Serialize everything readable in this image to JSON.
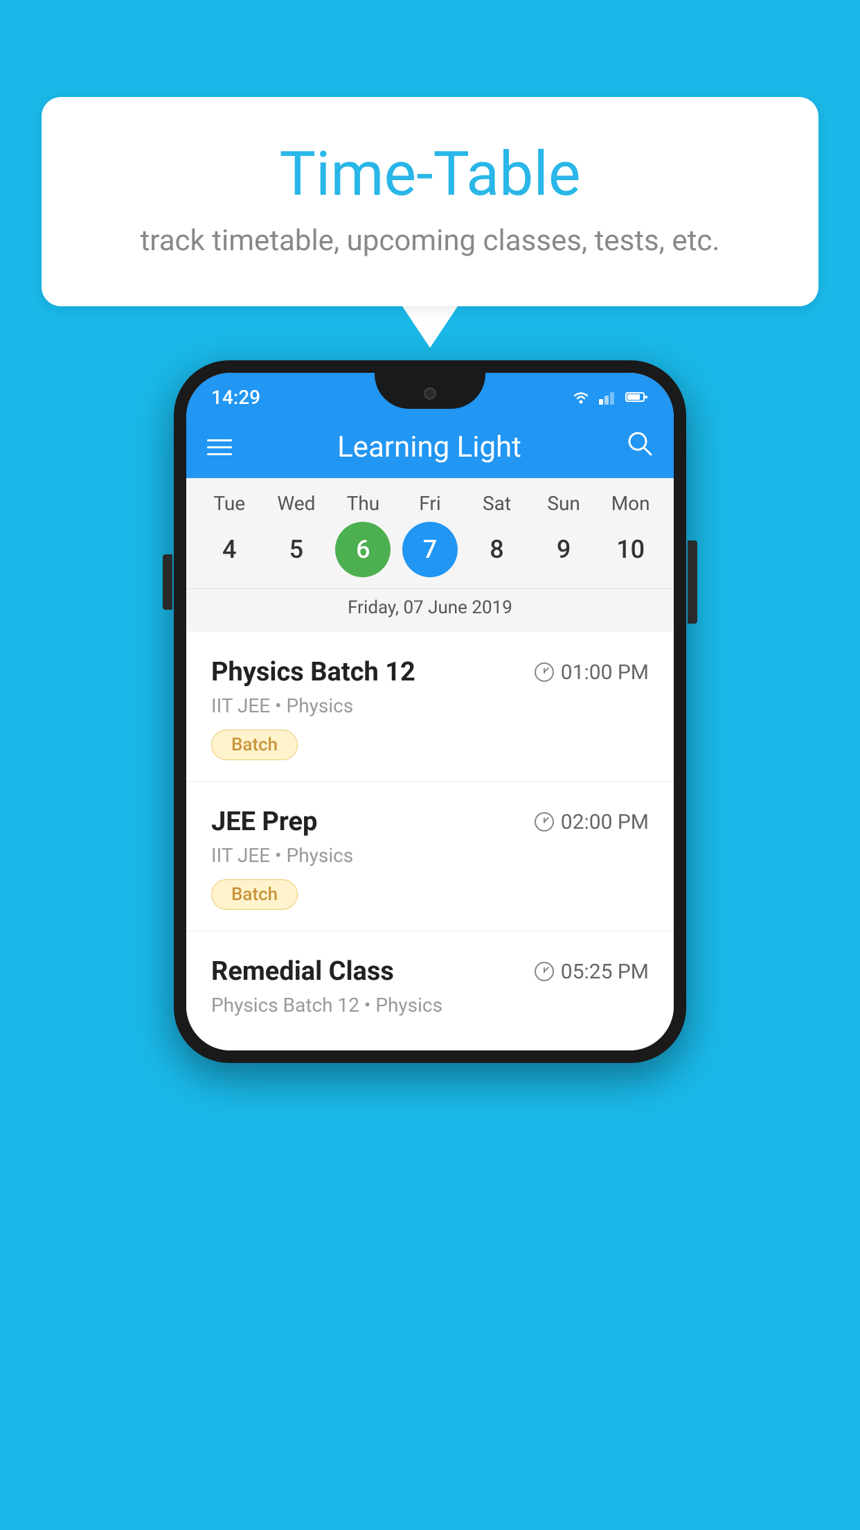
{
  "background_color": "#1ab8e8",
  "speech_bubble": {
    "title": "Time-Table",
    "subtitle": "track timetable, upcoming classes, tests, etc."
  },
  "phone": {
    "status_bar": {
      "time": "14:29"
    },
    "app_bar": {
      "title": "Learning Light"
    },
    "calendar": {
      "days": [
        {
          "label": "Tue",
          "number": "4"
        },
        {
          "label": "Wed",
          "number": "5"
        },
        {
          "label": "Thu",
          "number": "6",
          "state": "today"
        },
        {
          "label": "Fri",
          "number": "7",
          "state": "selected"
        },
        {
          "label": "Sat",
          "number": "8"
        },
        {
          "label": "Sun",
          "number": "9"
        },
        {
          "label": "Mon",
          "number": "10"
        }
      ],
      "selected_date_label": "Friday, 07 June 2019"
    },
    "classes": [
      {
        "title": "Physics Batch 12",
        "time": "01:00 PM",
        "subtitle": "IIT JEE • Physics",
        "badge": "Batch"
      },
      {
        "title": "JEE Prep",
        "time": "02:00 PM",
        "subtitle": "IIT JEE • Physics",
        "badge": "Batch"
      },
      {
        "title": "Remedial Class",
        "time": "05:25 PM",
        "subtitle": "Physics Batch 12 • Physics",
        "badge": ""
      }
    ]
  }
}
